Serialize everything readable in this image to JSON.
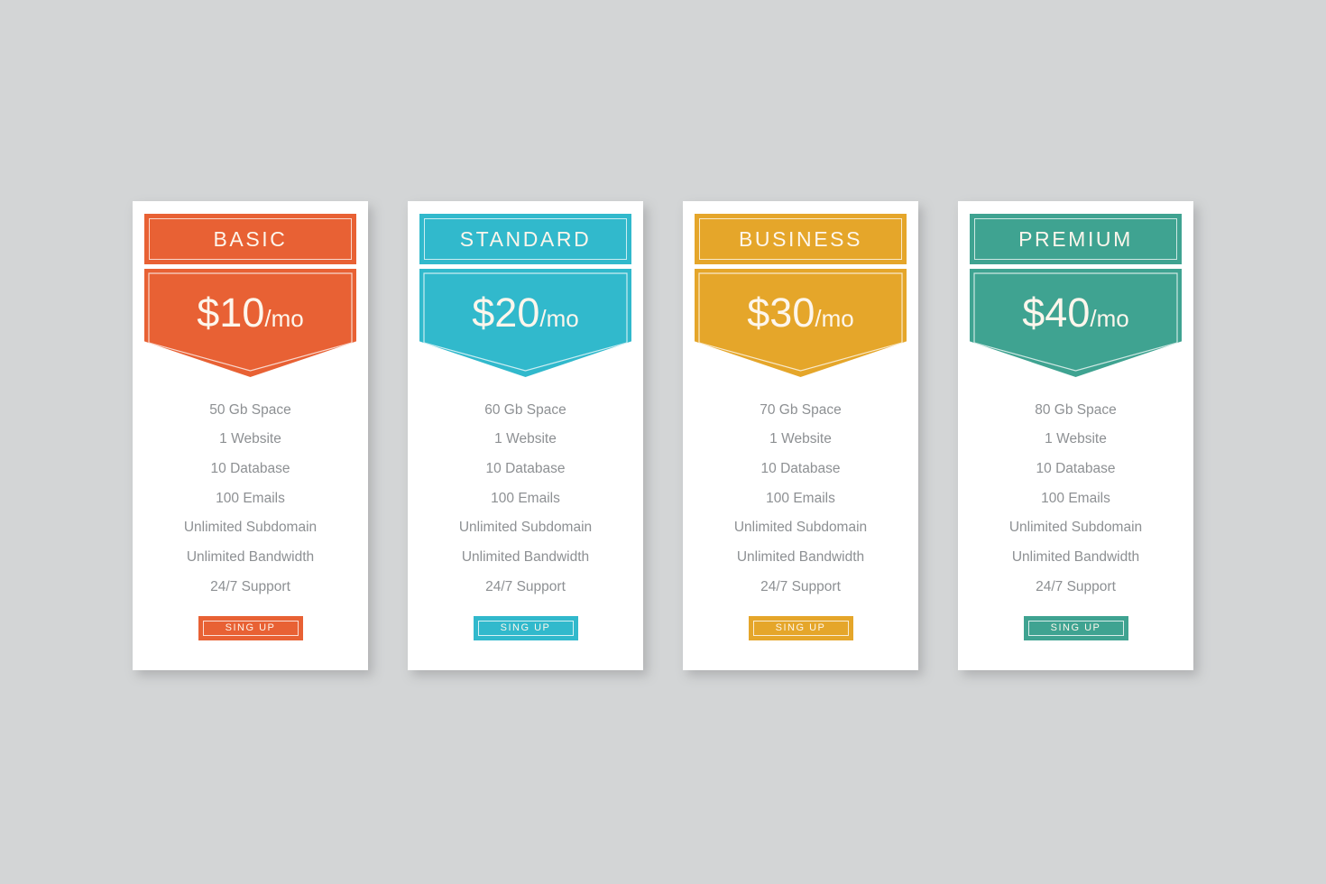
{
  "page": {
    "background_color": "#d3d5d6",
    "card_background": "#ffffff"
  },
  "plans": [
    {
      "name": "BASIC",
      "accent_color": "#e86134",
      "price_amount": "$10",
      "price_period": "/mo",
      "features": [
        "50 Gb Space",
        "1 Website",
        "10 Database",
        "100 Emails",
        "Unlimited Subdomain",
        "Unlimited Bandwidth",
        "24/7 Support"
      ],
      "button_label": "SING UP"
    },
    {
      "name": "STANDARD",
      "accent_color": "#31b9cc",
      "price_amount": "$20",
      "price_period": "/mo",
      "features": [
        "60 Gb Space",
        "1 Website",
        "10 Database",
        "100 Emails",
        "Unlimited Subdomain",
        "Unlimited Bandwidth",
        "24/7 Support"
      ],
      "button_label": "SING UP"
    },
    {
      "name": "BUSINESS",
      "accent_color": "#e5a62a",
      "price_amount": "$30",
      "price_period": "/mo",
      "features": [
        "70 Gb Space",
        "1 Website",
        "10 Database",
        "100 Emails",
        "Unlimited Subdomain",
        "Unlimited Bandwidth",
        "24/7 Support"
      ],
      "button_label": "SING UP"
    },
    {
      "name": "PREMIUM",
      "accent_color": "#3fa391",
      "price_amount": "$40",
      "price_period": "/mo",
      "features": [
        "80 Gb Space",
        "1 Website",
        "10 Database",
        "100 Emails",
        "Unlimited Subdomain",
        "Unlimited Bandwidth",
        "24/7 Support"
      ],
      "button_label": "SING UP"
    }
  ]
}
